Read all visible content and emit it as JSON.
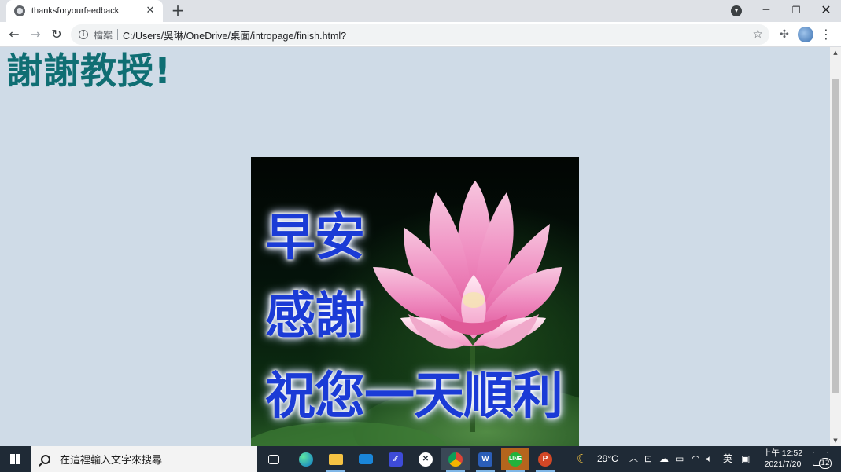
{
  "browser": {
    "tab_title": "thanksforyourfeedback",
    "new_tab": "+",
    "tab_close": "✕",
    "address": {
      "chip": "檔案",
      "url": "C:/Users/吳琳/OneDrive/桌面/intropage/finish.html?"
    }
  },
  "page": {
    "heading": "謝謝教授!",
    "image": {
      "line1": "早安",
      "line2": "感謝",
      "line3": "祝您一天順利"
    }
  },
  "taskbar": {
    "search_placeholder": "在這裡輸入文字來搜尋",
    "temperature": "29°C",
    "ime": "英",
    "time": "上午 12:52",
    "date": "2021/7/20",
    "notifications": "12"
  },
  "colors": {
    "page_bg": "#cfdbe7",
    "heading": "#0f6e73",
    "greeting_text": "#1b3bd6",
    "taskbar_bg": "#1f2a36"
  }
}
